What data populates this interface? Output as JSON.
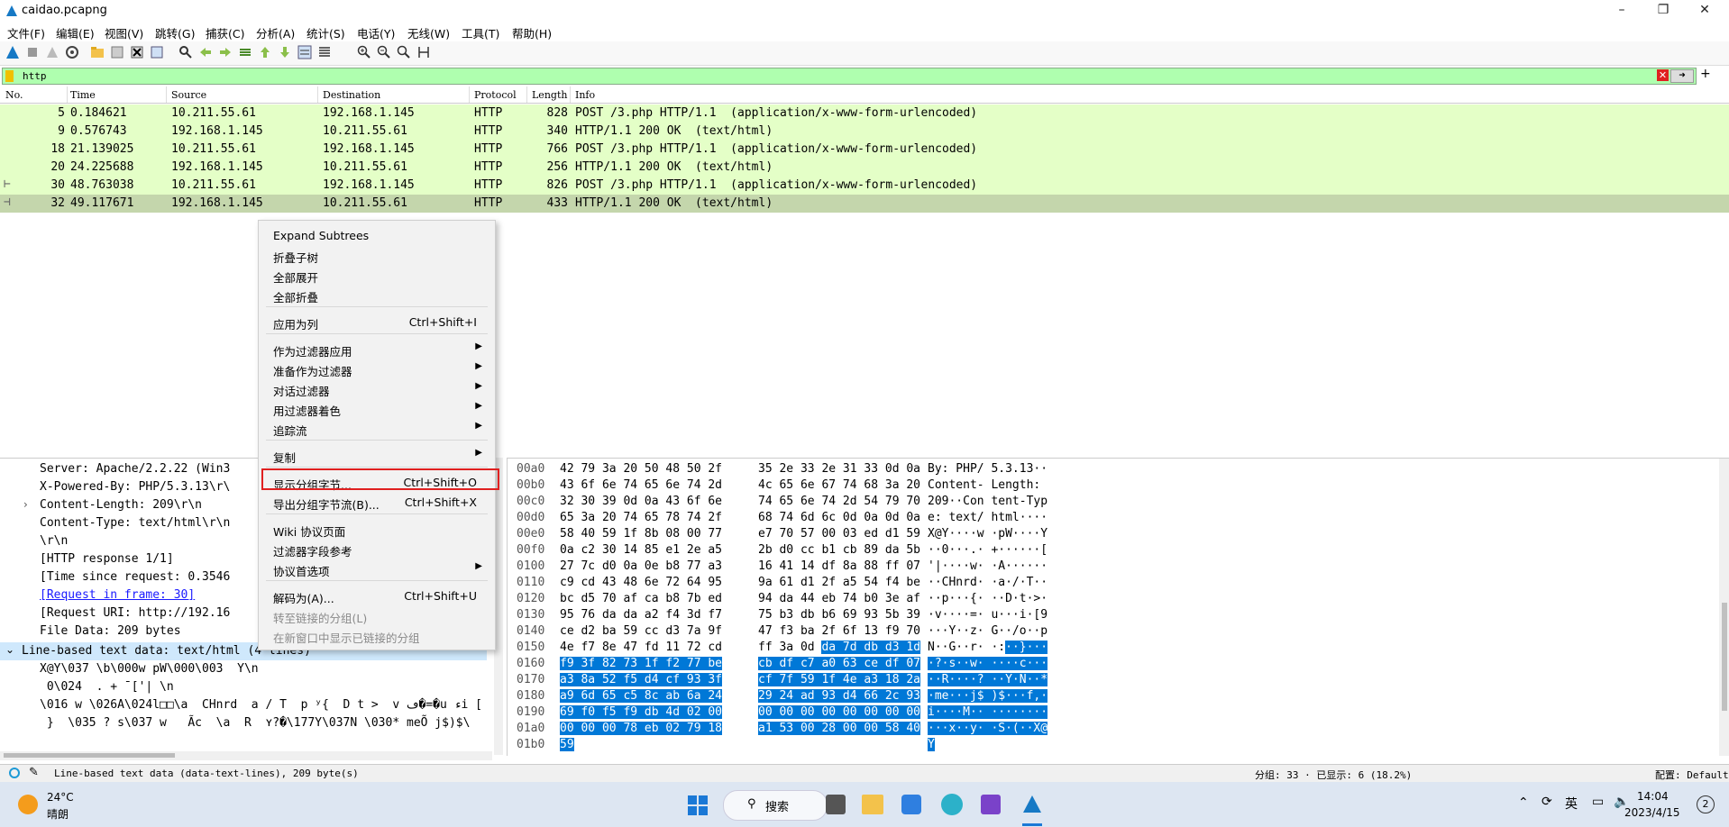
{
  "window": {
    "title": "caidao.pcapng"
  },
  "menu": [
    "文件(F)",
    "编辑(E)",
    "视图(V)",
    "跳转(G)",
    "捕获(C)",
    "分析(A)",
    "统计(S)",
    "电话(Y)",
    "无线(W)",
    "工具(T)",
    "帮助(H)"
  ],
  "filter": {
    "value": "http"
  },
  "packet_list": {
    "columns": [
      "No.",
      "Time",
      "Source",
      "Destination",
      "Protocol",
      "Length",
      "Info"
    ],
    "rows": [
      {
        "no": "5",
        "time": "0.184621",
        "src": "10.211.55.61",
        "dst": "192.168.1.145",
        "proto": "HTTP",
        "len": "828",
        "info": "POST /3.php HTTP/1.1  (application/x-www-form-urlencoded)"
      },
      {
        "no": "9",
        "time": "0.576743",
        "src": "192.168.1.145",
        "dst": "10.211.55.61",
        "proto": "HTTP",
        "len": "340",
        "info": "HTTP/1.1 200 OK  (text/html)"
      },
      {
        "no": "18",
        "time": "21.139025",
        "src": "10.211.55.61",
        "dst": "192.168.1.145",
        "proto": "HTTP",
        "len": "766",
        "info": "POST /3.php HTTP/1.1  (application/x-www-form-urlencoded)"
      },
      {
        "no": "20",
        "time": "24.225688",
        "src": "192.168.1.145",
        "dst": "10.211.55.61",
        "proto": "HTTP",
        "len": "256",
        "info": "HTTP/1.1 200 OK  (text/html)"
      },
      {
        "no": "30",
        "time": "48.763038",
        "src": "10.211.55.61",
        "dst": "192.168.1.145",
        "proto": "HTTP",
        "len": "826",
        "info": "POST /3.php HTTP/1.1  (application/x-www-form-urlencoded)"
      },
      {
        "no": "32",
        "time": "49.117671",
        "src": "192.168.1.145",
        "dst": "10.211.55.61",
        "proto": "HTTP",
        "len": "433",
        "info": "HTTP/1.1 200 OK  (text/html)"
      }
    ]
  },
  "details": {
    "lines": [
      "Server: Apache/2.2.22 (Win3",
      "X-Powered-By: PHP/5.3.13\\r\\",
      "Content-Length: 209\\r\\n",
      "Content-Type: text/html\\r\\n",
      "\\r\\n",
      "[HTTP response 1/1]",
      "[Time since request: 0.3546",
      "[Request in frame: 30]",
      "[Request URI: http://192.16",
      "File Data: 209 bytes",
      "Line-based text data: text/html (4 lines)",
      "X@Y\\037 \\b\\000w pW\\000\\003  Y\\n",
      " 0\\024  . + ̄ ['| \\n",
      "\\016 w \\026A\\024l□□\\a  CHnrd  a / T  p ʸ{  D t >  v ڡ�=�u ءi [",
      " }  \\035 ? s\\037 w   Ãc  \\a  R  ʏ?�\\177Y\\037N \\030* meÕ j$)$\\"
    ]
  },
  "hex": {
    "offsets": [
      "00a0",
      "00b0",
      "00c0",
      "00d0",
      "00e0",
      "00f0",
      "0100",
      "0110",
      "0120",
      "0130",
      "0140",
      "0150",
      "0160",
      "0170",
      "0180",
      "0190",
      "01a0",
      "01b0"
    ],
    "rows": [
      [
        "42 79 3a 20 50 48 50 2f",
        "35 2e 33 2e 31 33 0d 0a",
        "By: PHP/ 5.3.13··"
      ],
      [
        "43 6f 6e 74 65 6e 74 2d",
        "4c 65 6e 67 74 68 3a 20",
        "Content- Length:"
      ],
      [
        "32 30 39 0d 0a 43 6f 6e",
        "74 65 6e 74 2d 54 79 70",
        "209··Con tent-Typ"
      ],
      [
        "65 3a 20 74 65 78 74 2f",
        "68 74 6d 6c 0d 0a 0d 0a",
        "e: text/ html····"
      ],
      [
        "58 40 59 1f 8b 08 00 77",
        "e7 70 57 00 03 ed d1 59",
        "X@Y····w ·pW····Y"
      ],
      [
        "0a c2 30 14 85 e1 2e a5",
        "2b d0 cc b1 cb 89 da 5b",
        "··0···.· +······["
      ],
      [
        "27 7c d0 0a 0e b8 77 a3",
        "16 41 14 df 8a 88 ff 07",
        "'|····w· ·A······"
      ],
      [
        "c9 cd 43 48 6e 72 64 95",
        "9a 61 d1 2f a5 54 f4 be",
        "··CHnrd· ·a·/·T··"
      ],
      [
        "bc d5 70 af ca b8 7b ed",
        "94 da 44 eb 74 b0 3e af",
        "··p···{· ··D·t·>·"
      ],
      [
        "95 76 da da a2 f4 3d f7",
        "75 b3 db b6 69 93 5b 39",
        "·v····=· u···i·[9"
      ],
      [
        "ce d2 ba 59 cc d3 7a 9f",
        "47 f3 ba 2f 6f 13 f9 70",
        "···Y··z· G··/o··p"
      ],
      [
        "4e f7 8e 47 fd 11 72 cd",
        "ff 3a 0d da 7d db d3 1d",
        "N··G··r· ·:··}···"
      ],
      [
        "f9 3f 82 73 1f f2 77 be",
        "cb df c7 a0 63 ce df 07",
        "·?·s··w· ····c···"
      ],
      [
        "a3 8a 52 f5 d4 cf 93 3f",
        "cf 7f 59 1f 4e a3 18 2a",
        "··R····? ··Y·N··*"
      ],
      [
        "a9 6d 65 c5 8c ab 6a 24",
        "29 24 ad 93 d4 66 2c 93",
        "·me···j$ )$···f,·"
      ],
      [
        "69 f0 f5 f9 db 4d 02 00",
        "00 00 00 00 00 00 00 00",
        "i····M·· ········"
      ],
      [
        "00 00 00 78 eb 02 79 18",
        "a1 53 00 28 00 00 58 40",
        "···x··y· ·S·(··X@"
      ],
      [
        "59",
        "",
        "Y"
      ]
    ]
  },
  "context_menu": {
    "items": [
      {
        "label": "Expand Subtrees",
        "shortcut": "",
        "sub": false,
        "disabled": false
      },
      {
        "label": "折叠子树",
        "shortcut": "",
        "sub": false,
        "disabled": false
      },
      {
        "label": "全部展开",
        "shortcut": "",
        "sub": false,
        "disabled": false
      },
      {
        "label": "全部折叠",
        "shortcut": "",
        "sub": false,
        "disabled": false
      },
      {
        "label": "应用为列",
        "shortcut": "Ctrl+Shift+I",
        "sub": false,
        "disabled": false
      },
      {
        "label": "作为过滤器应用",
        "shortcut": "",
        "sub": true,
        "disabled": false
      },
      {
        "label": "准备作为过滤器",
        "shortcut": "",
        "sub": true,
        "disabled": false
      },
      {
        "label": "对话过滤器",
        "shortcut": "",
        "sub": true,
        "disabled": false
      },
      {
        "label": "用过滤器着色",
        "shortcut": "",
        "sub": true,
        "disabled": false
      },
      {
        "label": "追踪流",
        "shortcut": "",
        "sub": true,
        "disabled": false
      },
      {
        "label": "复制",
        "shortcut": "",
        "sub": true,
        "disabled": false
      },
      {
        "label": "显示分组字节...",
        "shortcut": "Ctrl+Shift+O",
        "sub": false,
        "disabled": false
      },
      {
        "label": "导出分组字节流(B)...",
        "shortcut": "Ctrl+Shift+X",
        "sub": false,
        "disabled": false
      },
      {
        "label": "Wiki 协议页面",
        "shortcut": "",
        "sub": false,
        "disabled": false
      },
      {
        "label": "过滤器字段参考",
        "shortcut": "",
        "sub": false,
        "disabled": false
      },
      {
        "label": "协议首选项",
        "shortcut": "",
        "sub": true,
        "disabled": false
      },
      {
        "label": "解码为(A)...",
        "shortcut": "Ctrl+Shift+U",
        "sub": false,
        "disabled": false
      },
      {
        "label": "转至链接的分组(L)",
        "shortcut": "",
        "sub": false,
        "disabled": true
      },
      {
        "label": "在新窗口中显示已链接的分组",
        "shortcut": "",
        "sub": false,
        "disabled": true
      }
    ]
  },
  "status": {
    "field_text": "Line-based text data (data-text-lines), 209 byte(s)",
    "packets": "分组: 33 · 已显示: 6 (18.2%)",
    "profile": "配置: Default"
  },
  "taskbar": {
    "weather_temp": "24°C",
    "weather_desc": "晴朗",
    "search_label": "搜索",
    "ime": "英",
    "time": "14:04",
    "date": "2023/4/15",
    "notifications": "2"
  },
  "colors": {
    "row_bg": "#e4ffc7",
    "row_sel": "#c4d6ac",
    "filter_bg": "#afffaf",
    "hex_highlight": "#0078d7",
    "menu_highlight_border": "#e02020"
  }
}
